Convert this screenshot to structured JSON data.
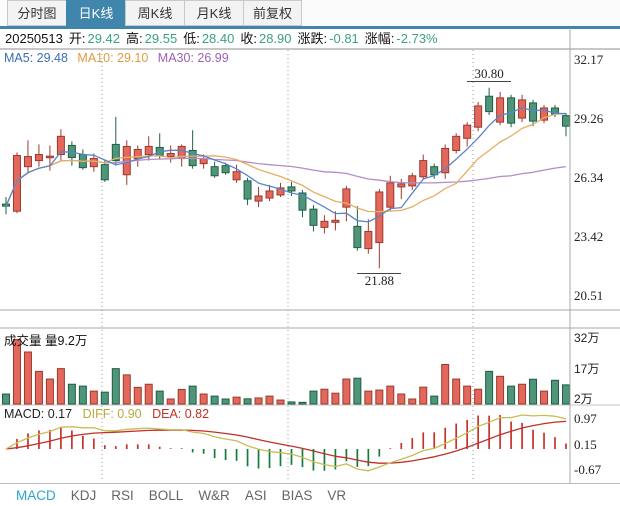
{
  "window_title": "日K线",
  "tabs": {
    "items": [
      "分时图",
      "日K线",
      "周K线",
      "月K线",
      "前复权"
    ],
    "selected": "日K线"
  },
  "info": {
    "date": "20250513",
    "open_label": "开:",
    "open": "29.42",
    "high_label": "高:",
    "high": "29.55",
    "low_label": "低:",
    "low": "28.40",
    "close_label": "收:",
    "close": "28.90",
    "change_label": "涨跌:",
    "change": "-0.81",
    "pct_label": "涨幅:",
    "pct": "-2.73%"
  },
  "ma_labels": {
    "ma5": "MA5: 29.48",
    "ma10": "MA10: 29.10",
    "ma30": "MA30: 26.99"
  },
  "price_axis": [
    "32.17",
    "29.26",
    "26.34",
    "23.42",
    "20.51"
  ],
  "volume_pane": {
    "label": "成交量 量9.2万",
    "axis": [
      "32万",
      "17万",
      "2万"
    ]
  },
  "macd_pane": {
    "macd": "MACD: 0.17",
    "diff": "DIFF: 0.90",
    "dea": "DEA: 0.82",
    "axis": [
      "0.97",
      "0.15",
      "-0.67"
    ]
  },
  "indicator_tabs": {
    "items": [
      "MACD",
      "KDJ",
      "RSI",
      "BOLL",
      "W&R",
      "ASI",
      "BIAS",
      "VR"
    ],
    "selected": "MACD"
  },
  "annotations": {
    "high": "30.80",
    "low": "21.88"
  },
  "colors": {
    "up_fill": "#e2685c",
    "up_stroke": "#9e382e",
    "down_fill": "#4e957a",
    "down_stroke": "#1f5f44",
    "ma5": "#5b85c8",
    "ma10": "#e6ae62",
    "ma30": "#b68cc8",
    "diff_line": "#c9bc55",
    "dea_line": "#c03028",
    "hist_up": "#c8322b",
    "hist_down": "#157a3a",
    "tab_accent": "#4086ac",
    "indicator_selected": "#2ba6cf",
    "value_green": "#3ba181",
    "grid": "#9a9a9a",
    "border": "#a8a8a8"
  },
  "chart_data": {
    "type": "candlestick",
    "title": "Daily K-line with volume and MACD",
    "price_axis_ticks": [
      32.17,
      29.26,
      26.34,
      23.42,
      20.51
    ],
    "volume_axis_ticks_wan": [
      32,
      17,
      2
    ],
    "macd_axis_ticks": [
      0.97,
      0.15,
      -0.67
    ],
    "today": {
      "date": "20250513",
      "open": 29.42,
      "high": 29.55,
      "low": 28.4,
      "close": 28.9,
      "change": -0.81,
      "change_pct": "-2.73%"
    },
    "indicators_shown": {
      "ma5": 29.48,
      "ma10": 29.1,
      "ma30": 26.99,
      "macd": 0.17,
      "diff": 0.9,
      "dea": 0.82,
      "volume_wan": 9.2
    },
    "high_annotation": {
      "text": "30.80",
      "candle_index": 44,
      "value": 30.8
    },
    "low_annotation": {
      "text": "21.88",
      "candle_index": 34,
      "value": 21.88
    },
    "candles_ohlc": [
      [
        25.05,
        25.4,
        24.55,
        24.95
      ],
      [
        24.7,
        27.6,
        24.6,
        27.45
      ],
      [
        26.9,
        28.2,
        26.55,
        27.4
      ],
      [
        27.2,
        28.0,
        26.9,
        27.5
      ],
      [
        27.35,
        27.95,
        26.7,
        27.42
      ],
      [
        27.5,
        28.75,
        27.15,
        28.4
      ],
      [
        27.95,
        28.15,
        26.95,
        27.35
      ],
      [
        27.5,
        27.75,
        26.75,
        26.85
      ],
      [
        26.9,
        27.55,
        26.65,
        27.3
      ],
      [
        27.0,
        27.2,
        26.15,
        26.25
      ],
      [
        28.0,
        29.36,
        26.95,
        27.2
      ],
      [
        26.5,
        28.2,
        26.0,
        27.9
      ],
      [
        27.3,
        27.95,
        26.9,
        27.75
      ],
      [
        27.5,
        28.4,
        27.2,
        27.9
      ],
      [
        27.85,
        28.55,
        27.3,
        27.45
      ],
      [
        27.4,
        27.95,
        27.1,
        27.55
      ],
      [
        27.3,
        28.0,
        26.9,
        27.9
      ],
      [
        27.7,
        28.7,
        26.8,
        26.95
      ],
      [
        27.05,
        27.5,
        26.8,
        27.3
      ],
      [
        26.9,
        27.15,
        26.35,
        26.45
      ],
      [
        26.95,
        27.1,
        26.5,
        26.6
      ],
      [
        26.25,
        27.0,
        26.1,
        26.65
      ],
      [
        26.2,
        26.35,
        25.0,
        25.3
      ],
      [
        25.2,
        25.9,
        24.9,
        25.45
      ],
      [
        25.35,
        26.0,
        25.2,
        25.7
      ],
      [
        25.5,
        26.1,
        25.4,
        25.85
      ],
      [
        25.9,
        26.15,
        25.45,
        25.7
      ],
      [
        25.6,
        25.75,
        24.4,
        24.75
      ],
      [
        24.8,
        25.0,
        23.7,
        24.0
      ],
      [
        23.9,
        24.5,
        23.6,
        24.2
      ],
      [
        24.15,
        24.7,
        23.75,
        24.25
      ],
      [
        24.9,
        25.95,
        24.2,
        25.8
      ],
      [
        23.95,
        24.95,
        22.75,
        22.9
      ],
      [
        22.85,
        24.3,
        22.6,
        23.7
      ],
      [
        23.15,
        25.8,
        21.88,
        25.65
      ],
      [
        24.9,
        26.45,
        24.7,
        26.1
      ],
      [
        25.9,
        26.3,
        25.3,
        26.05
      ],
      [
        25.95,
        26.6,
        25.75,
        26.45
      ],
      [
        26.4,
        27.5,
        26.25,
        27.2
      ],
      [
        26.9,
        27.05,
        26.3,
        26.5
      ],
      [
        26.6,
        28.0,
        26.3,
        27.8
      ],
      [
        27.7,
        28.55,
        27.55,
        28.4
      ],
      [
        28.3,
        29.1,
        27.9,
        28.95
      ],
      [
        28.85,
        30.1,
        28.65,
        29.9
      ],
      [
        30.38,
        30.8,
        29.45,
        29.62
      ],
      [
        29.1,
        30.6,
        28.95,
        30.3
      ],
      [
        30.3,
        30.45,
        28.85,
        29.05
      ],
      [
        29.3,
        30.45,
        29.1,
        30.2
      ],
      [
        30.05,
        30.2,
        28.9,
        29.15
      ],
      [
        29.2,
        29.95,
        29.05,
        29.8
      ],
      [
        29.8,
        29.95,
        29.35,
        29.5
      ],
      [
        29.42,
        29.55,
        28.4,
        28.9
      ]
    ],
    "volumes_wan": [
      4.8,
      31,
      25,
      15.7,
      12,
      17,
      9.5,
      8.6,
      6.2,
      5.7,
      17,
      14,
      8,
      9.5,
      6.2,
      2.4,
      7,
      8.6,
      4.8,
      3.8,
      2.4,
      3.3,
      2.5,
      2.9,
      3.8,
      1.9,
      1.0,
      0.8,
      6.2,
      7.1,
      5.2,
      12,
      12.4,
      6.2,
      6.7,
      8.6,
      4.8,
      2.4,
      8.1,
      3.8,
      19,
      12,
      8.6,
      7.1,
      15.7,
      13.3,
      8.6,
      9.5,
      11.9,
      6.2,
      11.4,
      9.2
    ],
    "legend": {
      "ma5": "MA5",
      "ma10": "MA10",
      "ma30": "MA30"
    },
    "grid": "vertical-dotted",
    "legend_position": "top-left"
  }
}
